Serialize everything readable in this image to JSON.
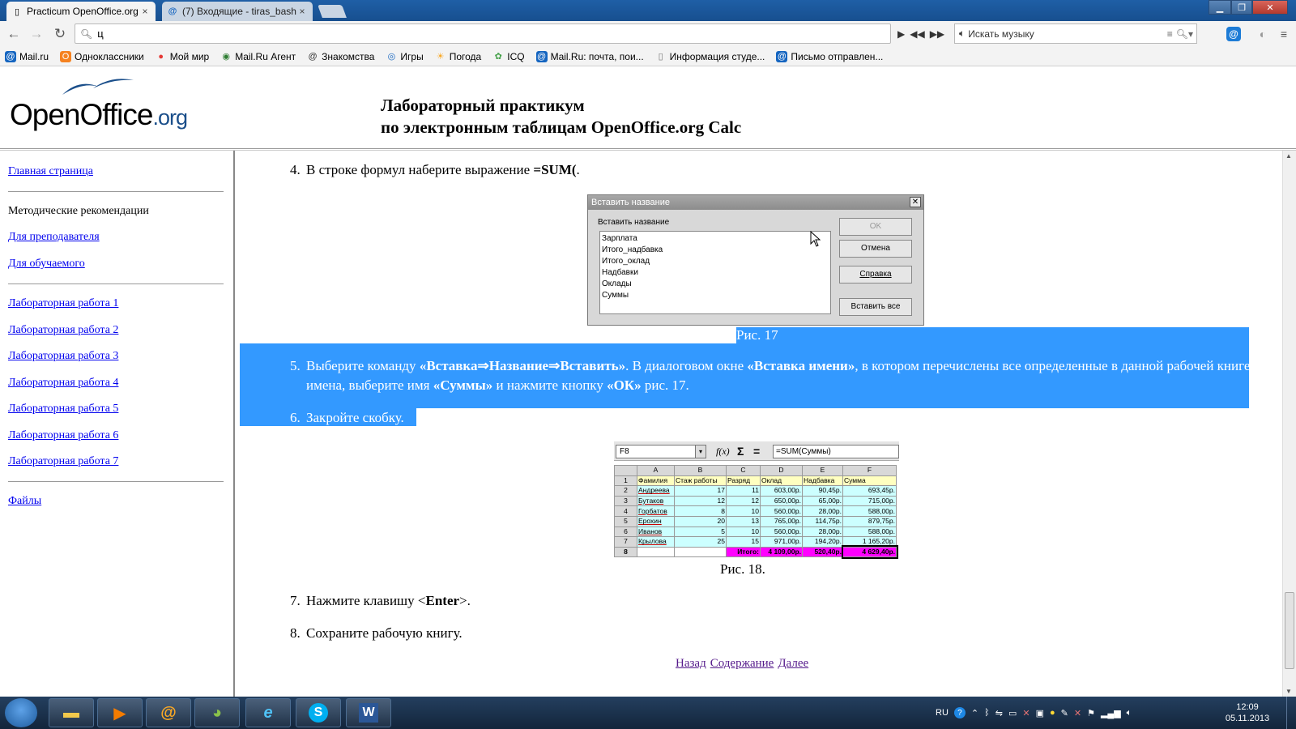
{
  "browser": {
    "tabs": [
      {
        "label": "Practicum OpenOffice.org",
        "close": "×"
      },
      {
        "label": "(7) Входящие - tiras_bash",
        "close": "×"
      }
    ],
    "address": "ц",
    "music_search_placeholder": "Искать музыку",
    "bookmarks": [
      "Mail.ru",
      "Одноклассники",
      "Мой мир",
      "Mail.Ru Агент",
      "Знакомства",
      "Игры",
      "Погода",
      "ICQ",
      "Mail.Ru: почта, пои...",
      "Информация студе...",
      "Письмо отправлен..."
    ]
  },
  "header": {
    "logo_main": "OpenOffice",
    "logo_suffix": ".org",
    "title_line1": "Лабораторный практикум",
    "title_line2": "по электронным таблицам OpenOffice.org Calc"
  },
  "sidebar": {
    "home": "Главная страница",
    "methodical": "Методические рекомендации",
    "for_teacher": "Для преподавателя",
    "for_student": "Для обучаемого",
    "labs": [
      "Лабораторная работа 1",
      "Лабораторная работа 2",
      "Лабораторная работа 3",
      "Лабораторная работа 4",
      "Лабораторная работа 5",
      "Лабораторная работа 6",
      "Лабораторная работа 7"
    ],
    "files": "Файлы"
  },
  "content": {
    "step4": {
      "num": "4.",
      "text": "В строке формул наберите выражение ",
      "bold": "=SUM(",
      "tail": "."
    },
    "dialog": {
      "title": "Вставить название",
      "close": "✕",
      "label": "Вставить название",
      "items": [
        "Зарплата",
        "Итого_надбавка",
        "Итого_оклад",
        "Надбавки",
        "Оклады",
        "Суммы"
      ],
      "buttons": {
        "ok": "OK",
        "cancel": "Отмена",
        "help": "Справка",
        "insert_all": "Вставить все"
      }
    },
    "caption17": "Рис. 17",
    "step5": {
      "num": "5.",
      "p1": "Выберите команду ",
      "b1": "«Вставка⇒Название⇒Вставить»",
      "p2": ". В диалоговом окне ",
      "b2": "«Вставка имени»",
      "p3": ", в котором перечислены все определенные в данной рабочей книге имена, выберите имя ",
      "b3": "«Суммы»",
      "p4": " и нажмите кнопку ",
      "b4": "«ОК»",
      "p5": " рис. 17."
    },
    "step6": {
      "num": "6.",
      "text": "Закройте скобку."
    },
    "spreadsheet": {
      "cell_ref": "F8",
      "dropdown": "▾",
      "fx": "f(x)",
      "sigma": "Σ",
      "equals": "=",
      "formula": "=SUM(Суммы)",
      "col_headers": [
        "A",
        "B",
        "C",
        "D",
        "E",
        "F"
      ],
      "row_headers": [
        "1",
        "2",
        "3",
        "4",
        "5",
        "6",
        "7",
        "8"
      ],
      "header_row": [
        "Фамилия",
        "Стаж работы",
        "Разряд",
        "Оклад",
        "Надбавка",
        "Сумма"
      ],
      "rows": [
        [
          "Андреева",
          "17",
          "11",
          "603,00р.",
          "90,45р.",
          "693,45р."
        ],
        [
          "Бутаков",
          "12",
          "12",
          "650,00р.",
          "65,00р.",
          "715,00р."
        ],
        [
          "Горбатов",
          "8",
          "10",
          "560,00р.",
          "28,00р.",
          "588,00р."
        ],
        [
          "Ерохин",
          "20",
          "13",
          "765,00р.",
          "114,75р.",
          "879,75р."
        ],
        [
          "Иванов",
          "5",
          "10",
          "560,00р.",
          "28,00р.",
          "588,00р."
        ],
        [
          "Крылова",
          "25",
          "15",
          "971,00р.",
          "194,20р.",
          "1 165,20р."
        ]
      ],
      "total_row": [
        "",
        "",
        "Итого:",
        "4 109,00р.",
        "520,40р.",
        "4 629,40р."
      ]
    },
    "caption18": "Рис. 18.",
    "step7": {
      "num": "7.",
      "p1": "Нажмите клавишу <",
      "bold": "Enter",
      "p2": ">."
    },
    "step8": {
      "num": "8.",
      "text": "Сохраните рабочую книгу."
    },
    "nav": {
      "back": "Назад",
      "contents": "Содержание",
      "next": "Далее"
    }
  },
  "taskbar": {
    "lang": "RU",
    "time": "12:09",
    "date": "05.11.2013"
  },
  "colors": {
    "selection": "#3399ff",
    "link": "#0000ee",
    "visited": "#551a8b",
    "magenta": "#ff00ff",
    "cyan_cell": "#ccffff",
    "yellow_cell": "#ffffc0"
  }
}
